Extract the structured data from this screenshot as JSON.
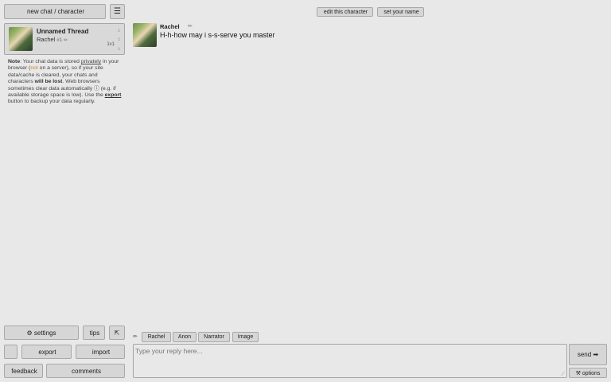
{
  "sidebar": {
    "new_chat_label": "new chat / character",
    "menu_icon": "☰",
    "thread": {
      "title": "Unnamed Thread",
      "character": "Rachel",
      "character_suffix": "#1",
      "edit_icon": "✏",
      "controls": [
        "↕",
        "↕",
        "↕"
      ],
      "count": "1x1"
    },
    "note": {
      "prefix": "Note",
      "t1": ": Your chat data is stored ",
      "privately": "privately",
      "t2": " in your browser (",
      "not": "not",
      "t3": " on a server), so if your site data/cache is cleared, your chats and characters ",
      "will_be_lost": "will be lost",
      "t4": ". Web browsers sometimes clear data automatically ⓘ (e.g. if available storage space is low). Use the ",
      "export": "export",
      "t5": " button to backup your data regularly."
    },
    "buttons": {
      "settings": "⚙ settings",
      "tips": "tips",
      "collapse": "⇱",
      "misc": "",
      "export": "export",
      "import": "import",
      "feedback": "feedback",
      "comments": "comments"
    }
  },
  "header": {
    "edit_character": "edit this character",
    "set_name": "set your name"
  },
  "messages": [
    {
      "author": "Rachel",
      "edit_icon": "✏",
      "text": "H-h-how may i s-s-serve you master"
    }
  ],
  "composer": {
    "pencil_icon": "✏",
    "quick_buttons": {
      "rachel": "Rachel",
      "anon": "Anon",
      "narrator": "Narrator",
      "image": "Image"
    },
    "placeholder": "Type your reply here...",
    "send_label": "send ➡",
    "options_label": "⚒ options"
  },
  "colors": {
    "background": "#e8e8e8",
    "button": "#d6d6d6",
    "border": "#a8a8a8",
    "accent_not": "#d97e1c"
  }
}
